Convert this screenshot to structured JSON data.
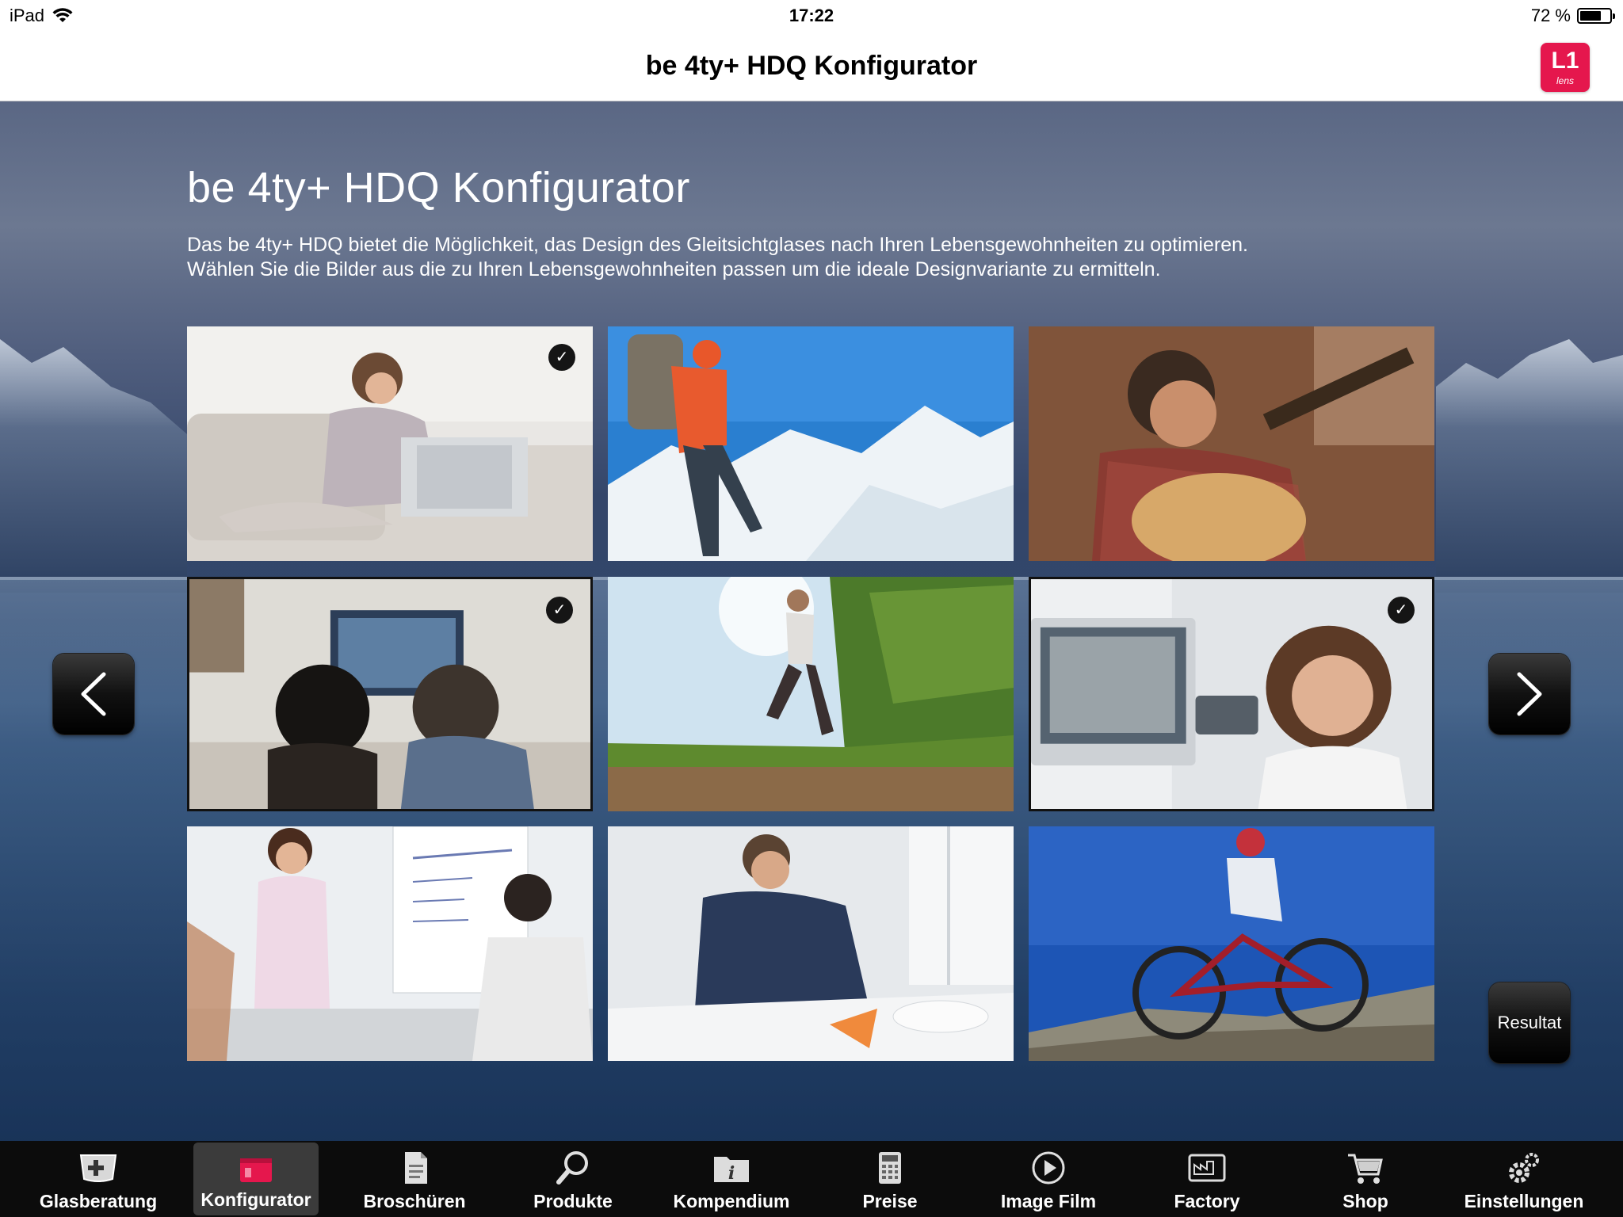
{
  "status_bar": {
    "device": "iPad",
    "time": "17:22",
    "battery": "72 %",
    "battery_level": 0.72
  },
  "nav": {
    "title": "be 4ty+ HDQ Konfigurator",
    "logo_text": "L1",
    "logo_subtext": "lens"
  },
  "page": {
    "heading": "be 4ty+ HDQ Konfigurator",
    "description_line1": "Das be 4ty+ HDQ bietet die Möglichkeit, das Design des Gleitsichtglases nach Ihren Lebensgewohnheiten zu optimieren.",
    "description_line2": "Wählen Sie die Bilder aus die zu Ihren Lebensgewohnheiten passen um die ideale Designvariante zu ermitteln."
  },
  "tiles": [
    {
      "scene": "woman-laptop-sofa",
      "selected": true
    },
    {
      "scene": "hiker-snow-mountains",
      "selected": false
    },
    {
      "scene": "man-playing-guitar",
      "selected": false
    },
    {
      "scene": "couple-watching-tv",
      "selected": true
    },
    {
      "scene": "runner-trail",
      "selected": false
    },
    {
      "scene": "woman-computer-office",
      "selected": true
    },
    {
      "scene": "business-presentation",
      "selected": false
    },
    {
      "scene": "man-drawing-plans",
      "selected": false
    },
    {
      "scene": "mountain-biker",
      "selected": false
    }
  ],
  "controls": {
    "prev_icon": "chevron-left-icon",
    "next_icon": "chevron-right-icon",
    "result_label": "Resultat"
  },
  "tabs": [
    {
      "label": "Glasberatung",
      "icon": "lens-plus-icon",
      "active": false
    },
    {
      "label": "Konfigurator",
      "icon": "configurator-icon",
      "active": true
    },
    {
      "label": "Broschüren",
      "icon": "brochure-icon",
      "active": false
    },
    {
      "label": "Produkte",
      "icon": "magnifier-icon",
      "active": false
    },
    {
      "label": "Kompendium",
      "icon": "info-folder-icon",
      "active": false
    },
    {
      "label": "Preise",
      "icon": "calculator-icon",
      "active": false
    },
    {
      "label": "Image Film",
      "icon": "play-icon",
      "active": false
    },
    {
      "label": "Factory",
      "icon": "factory-icon",
      "active": false
    },
    {
      "label": "Shop",
      "icon": "cart-icon",
      "active": false
    },
    {
      "label": "Einstellungen",
      "icon": "gear-icon",
      "active": false
    }
  ],
  "colors": {
    "accent": "#e5174d",
    "tab_bar": "#0c0c0c",
    "tab_active": "#3b3b3b"
  }
}
